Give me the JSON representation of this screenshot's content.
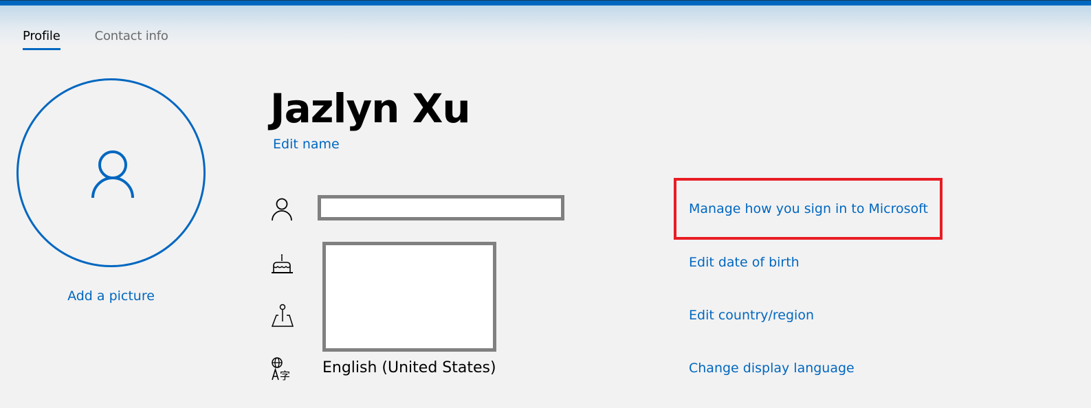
{
  "colors": {
    "accent": "#0067c0",
    "highlight": "#e81c24",
    "background": "#f2f2f2",
    "field_border": "#808080"
  },
  "tabs": [
    {
      "label": "Profile",
      "active": true
    },
    {
      "label": "Contact info",
      "active": false
    }
  ],
  "profile": {
    "avatar_icon": "person-icon",
    "add_picture_label": "Add a picture",
    "name": "Jazlyn Xu",
    "edit_name_label": "Edit name"
  },
  "info_rows": [
    {
      "icon": "person-icon",
      "value": ""
    },
    {
      "icon": "birthday-cake-icon",
      "value": ""
    },
    {
      "icon": "location-pin-icon",
      "value": ""
    },
    {
      "icon": "language-icon",
      "value": "English (United States)"
    }
  ],
  "actions": {
    "manage_signin": "Manage how you sign in to Microsoft",
    "edit_dob": "Edit date of birth",
    "edit_country": "Edit country/region",
    "change_language": "Change display language"
  }
}
